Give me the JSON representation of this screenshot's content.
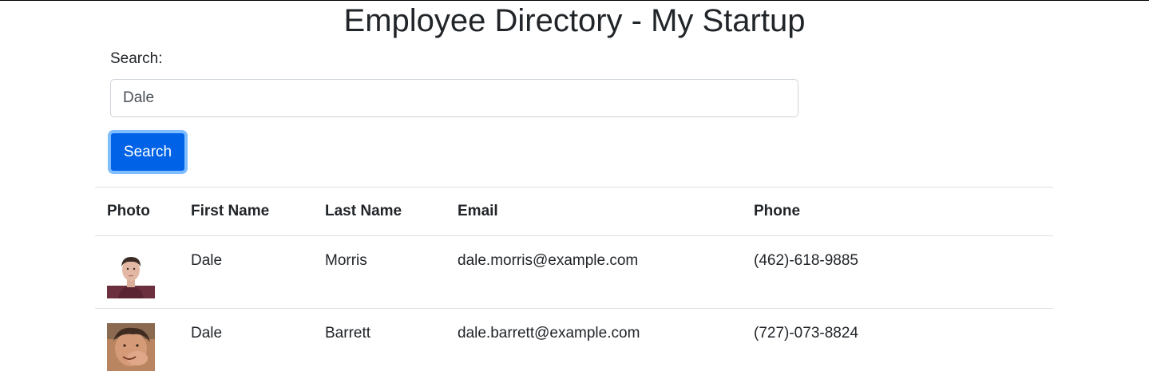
{
  "page": {
    "title": "Employee Directory - My Startup"
  },
  "search": {
    "label": "Search:",
    "value": "Dale",
    "button_label": "Search"
  },
  "table": {
    "headers": [
      "Photo",
      "First Name",
      "Last Name",
      "Email",
      "Phone"
    ],
    "rows": [
      {
        "photo": "avatar-dale-morris",
        "first_name": "Dale",
        "last_name": "Morris",
        "email": "dale.morris@example.com",
        "phone": "(462)-618-9885"
      },
      {
        "photo": "avatar-dale-barrett",
        "first_name": "Dale",
        "last_name": "Barrett",
        "email": "dale.barrett@example.com",
        "phone": "(727)-073-8824"
      }
    ]
  },
  "colors": {
    "button": "#0062e6",
    "button_focus_ring": "#80bdff",
    "text": "#212529",
    "border": "#dee2e6"
  }
}
